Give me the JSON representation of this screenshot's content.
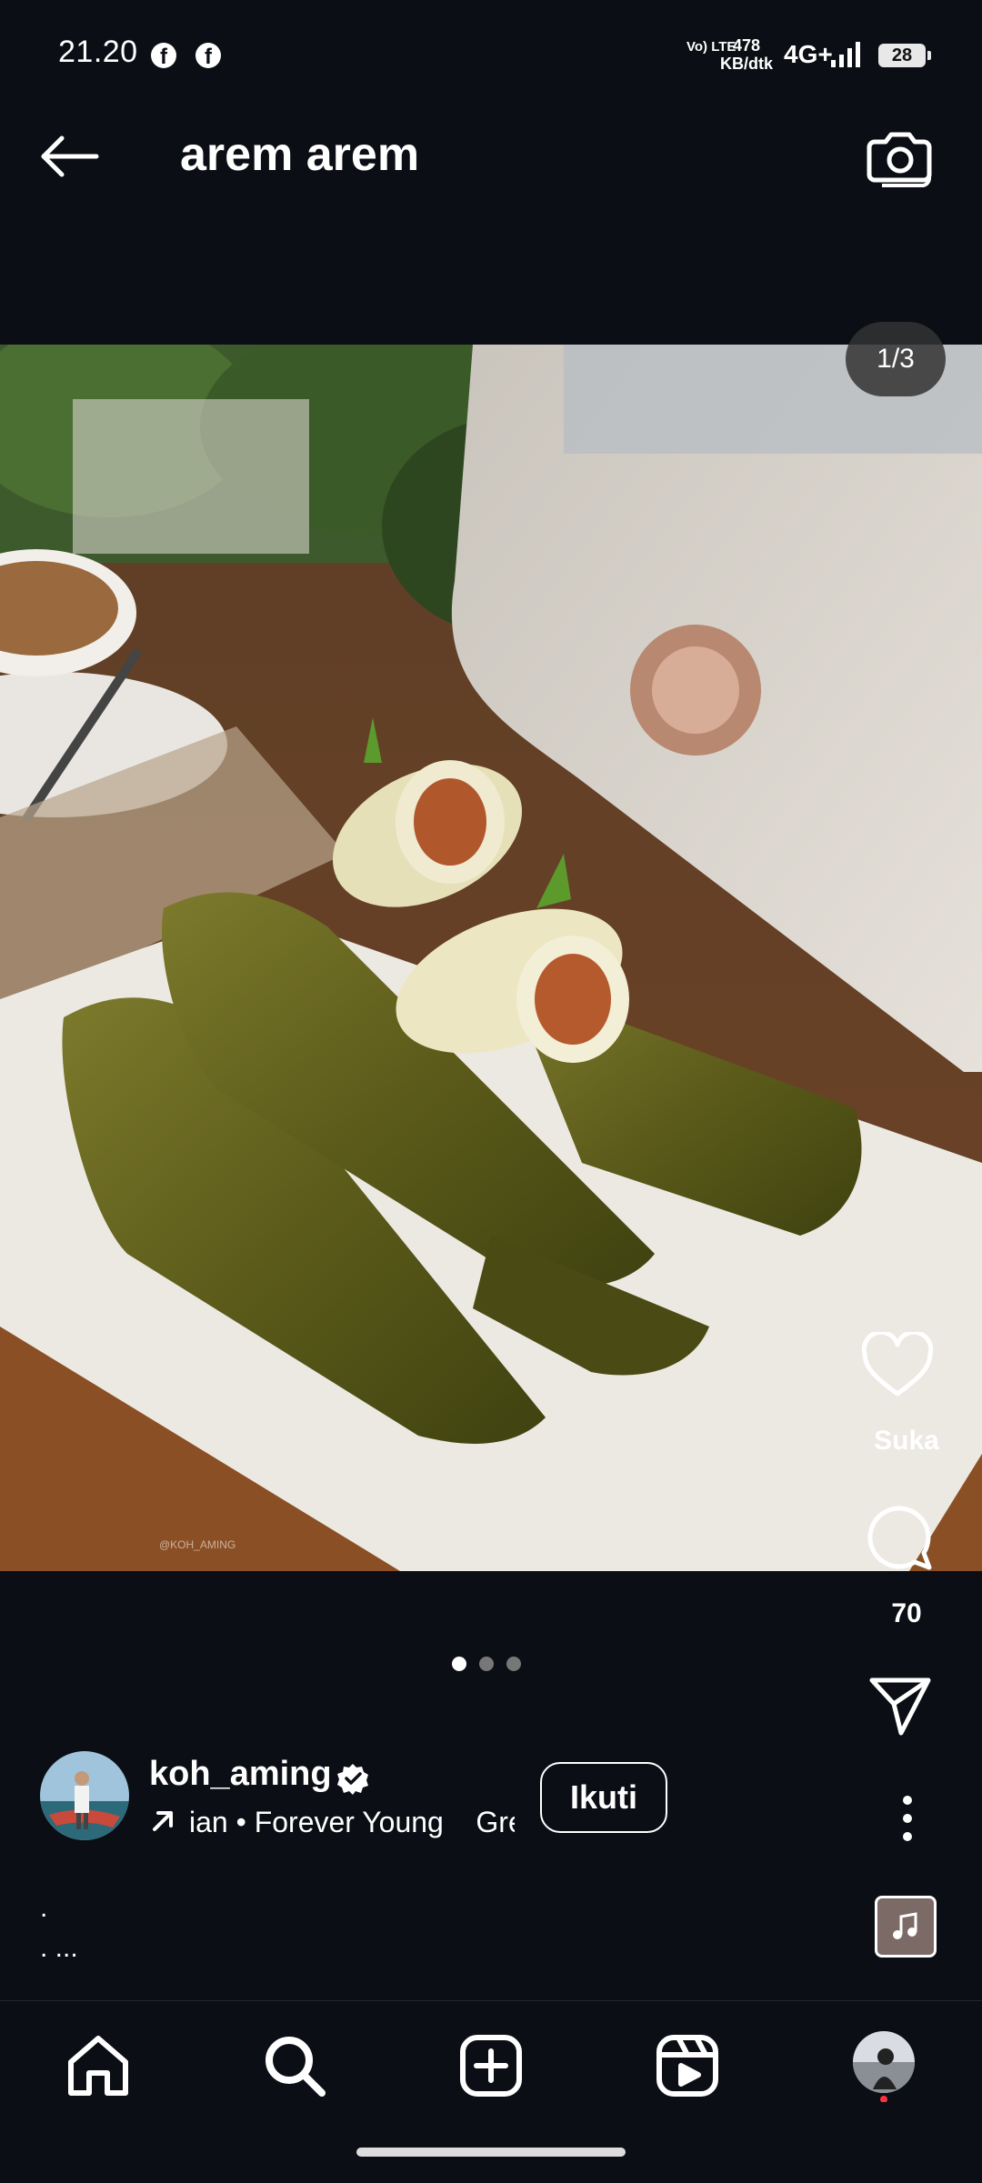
{
  "status_bar": {
    "time": "21.20",
    "volte": "Vo) LTE",
    "net_speed_value": "478",
    "net_speed_unit": "KB/dtk",
    "network": "4G+",
    "battery": "28"
  },
  "header": {
    "title": "arem arem"
  },
  "post": {
    "image_counter": "1/3",
    "watermark": "@KOH_AMING",
    "carousel_total": 3,
    "carousel_active": 1
  },
  "actions": {
    "like_label": "Suka",
    "comment_count": "70"
  },
  "author": {
    "username": "koh_aming",
    "music_text": "ian • Forever Young    Gre",
    "follow_label": "Ikuti"
  },
  "caption": {
    "line1": ".",
    "line2": ". ..."
  },
  "colors": {
    "background": "#0b0e14",
    "text": "#ffffff",
    "notification_dot": "#ff3040"
  },
  "icons": [
    "back-arrow-icon",
    "camera-icon",
    "heart-icon",
    "comment-icon",
    "send-icon",
    "more-vertical-icon",
    "music-note-icon",
    "home-icon",
    "search-icon",
    "create-icon",
    "reels-icon",
    "profile-avatar-icon",
    "verified-icon",
    "arrow-up-right-icon"
  ]
}
